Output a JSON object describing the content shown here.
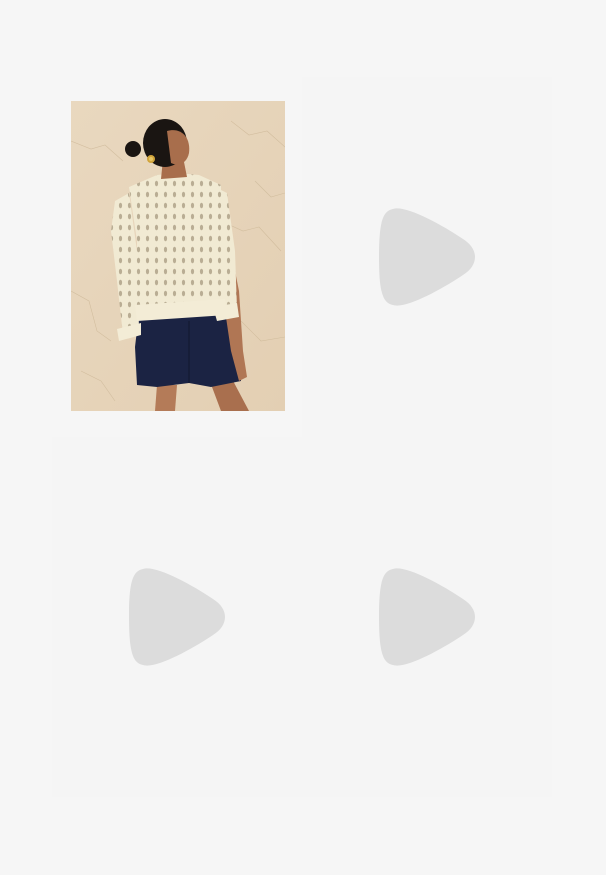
{
  "gallery": {
    "items": [
      {
        "type": "image",
        "icon": "product-photo",
        "description_colors": {
          "background": "#e8d6bd",
          "sweater": "#f1ead3",
          "shorts": "#1c2444",
          "skin": "#b07856",
          "hair": "#1a1512"
        }
      },
      {
        "type": "placeholder",
        "icon": "play-icon"
      },
      {
        "type": "placeholder",
        "icon": "play-icon"
      },
      {
        "type": "placeholder",
        "icon": "play-icon"
      }
    ]
  },
  "colors": {
    "page_background": "#f6f6f6",
    "tile_background": "#f5f5f5",
    "placeholder_icon": "#dcdcdc"
  }
}
